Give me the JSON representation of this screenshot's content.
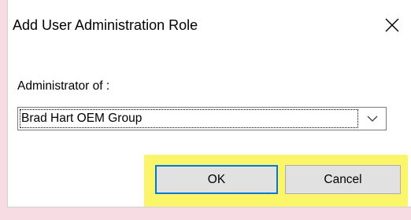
{
  "dialog": {
    "title": "Add User Administration Role",
    "close_icon": "close-icon"
  },
  "form": {
    "administrator_label": "Administrator of :",
    "administrator_select": {
      "selected_value": "Brad Hart OEM Group",
      "arrow_icon": "chevron-down-icon"
    }
  },
  "buttons": {
    "ok_label": "OK",
    "cancel_label": "Cancel"
  },
  "colors": {
    "highlight": "#fbf56a",
    "button_face": "#e1e1e1",
    "button_border": "#adadad",
    "default_button_border": "#0078d7",
    "backdrop_tint": "#f7dde3"
  }
}
